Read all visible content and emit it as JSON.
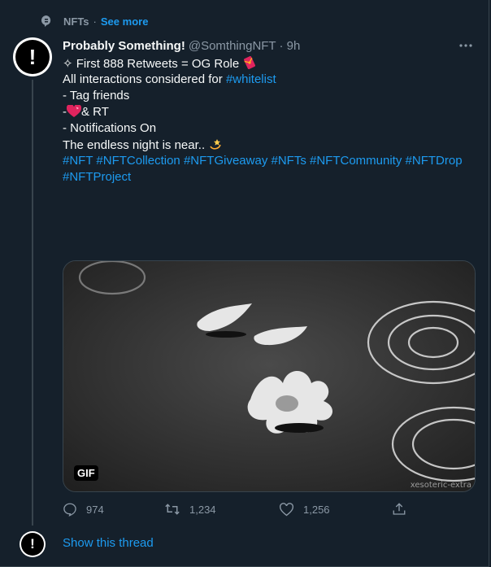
{
  "topic": {
    "name": "NFTs",
    "separator": "·",
    "see_more": "See more",
    "icon": "topic-bubble-icon"
  },
  "tweet": {
    "display_name": "Probably Something!",
    "handle_time": "@SomthingNFT · 9h",
    "avatar_glyph": "!",
    "lines": {
      "line1_text": "✧ First 888 Retweets = OG Role",
      "line2_text": "All interactions considered for ",
      "line2_tag": "#whitelist",
      "line3": "- Tag friends",
      "line4_prefix": "-",
      "line4_suffix": "& RT",
      "line5": "- Notifications On",
      "line6": "The endless night is near..",
      "hashtags_row1": [
        "#NFT",
        "#NFTCollection",
        "#NFTGiveaway",
        "#NFTs",
        "#NFTCommunity",
        "#NFTDrop"
      ],
      "hashtags_row2": [
        "#NFTProject"
      ]
    },
    "media": {
      "badge": "GIF",
      "watermark": "xesoteric-extra"
    },
    "actions": {
      "replies": "974",
      "retweets": "1,234",
      "likes": "1,256"
    }
  },
  "thread": {
    "show_label": "Show this thread"
  },
  "colors": {
    "background": "#15202b",
    "accent": "#1d9bf0",
    "secondary_text": "#8b98a5",
    "primary_text": "#f7f9f9"
  }
}
